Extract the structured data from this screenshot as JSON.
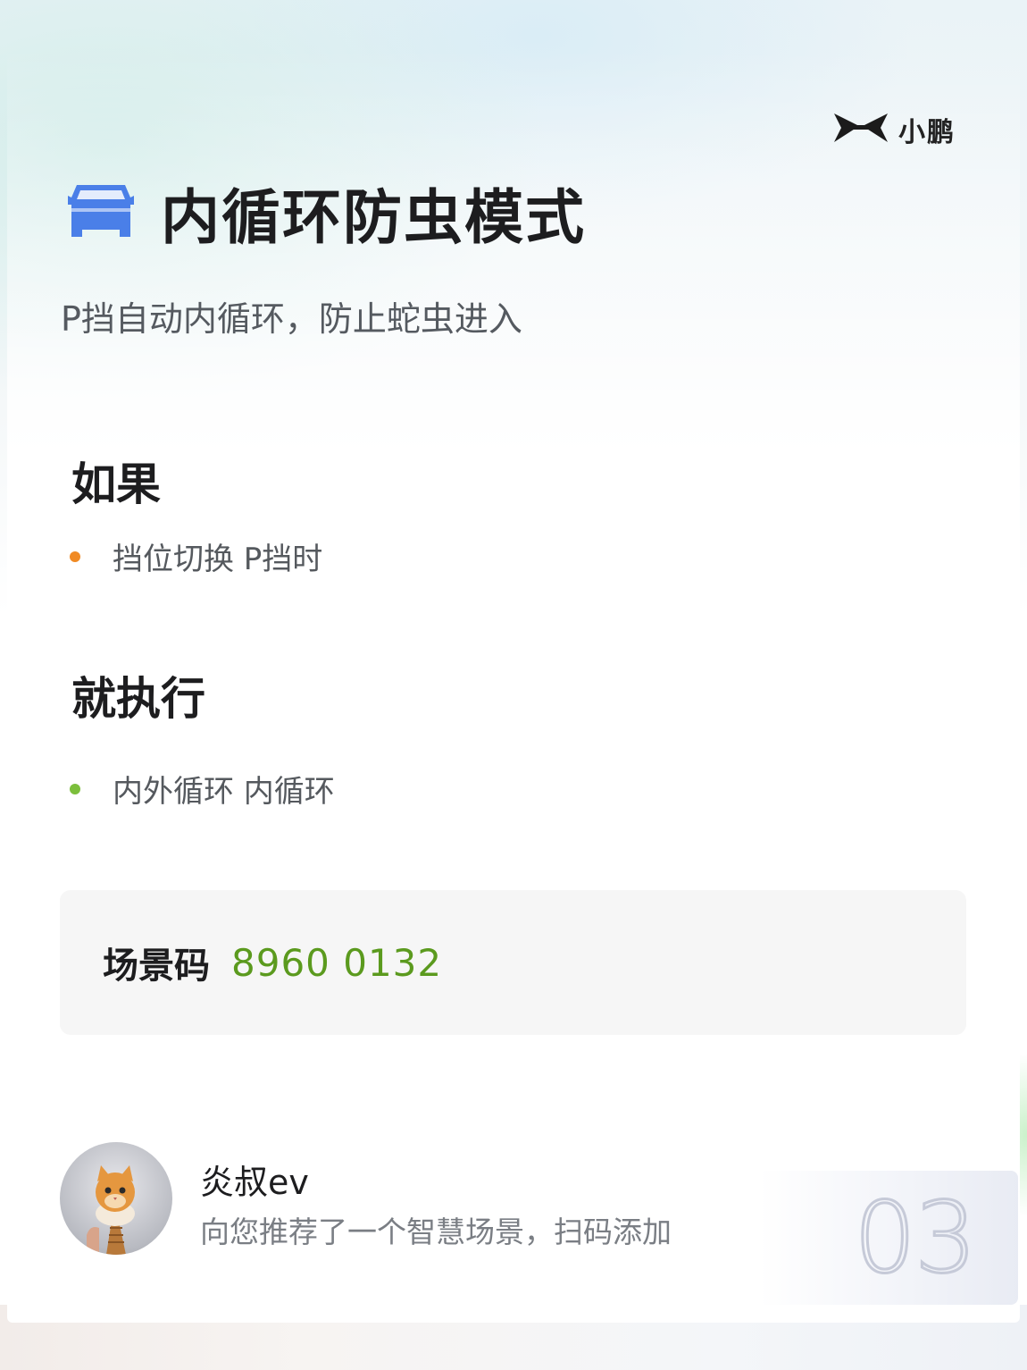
{
  "brand": {
    "name": "小鹏",
    "logo_icon": "xpeng-logo-icon"
  },
  "header": {
    "icon": "car-icon",
    "icon_color": "#4a7fe8",
    "title": "内循环防虫模式",
    "subtitle": "P挡自动内循环，防止蛇虫进入"
  },
  "if_section": {
    "heading": "如果",
    "bullet_color": "#f08a24",
    "items": [
      "挡位切换 P挡时"
    ]
  },
  "then_section": {
    "heading": "就执行",
    "bullet_color": "#7cbf3c",
    "items": [
      "内外循环 内循环"
    ]
  },
  "scene_code": {
    "label": "场景码",
    "value": "8960 0132",
    "value_color": "#5b9a1e"
  },
  "author": {
    "avatar_icon": "cat-avatar",
    "name": "炎叔ev",
    "message": "向您推荐了一个智慧场景，扫码添加"
  },
  "page_number": "03"
}
